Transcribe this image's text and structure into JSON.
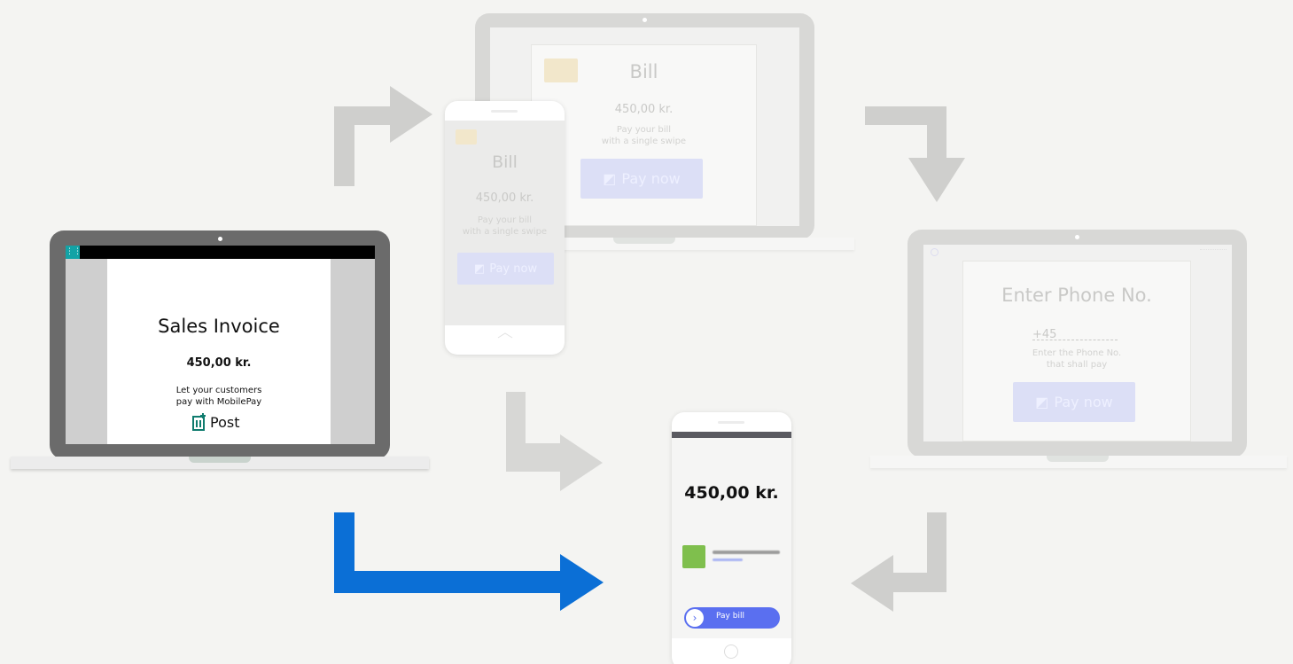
{
  "colors": {
    "background": "#f4f4f2",
    "arrow_gray": "#cfcfcd",
    "arrow_blue": "#0b6fd6",
    "accent_teal": "#13a3a6",
    "mobilepay_blue": "#5a6ff0"
  },
  "main_laptop": {
    "waffle_icon": "waffle-icon",
    "title": "Sales Invoice",
    "amount": "450,00 kr.",
    "desc_line1": "Let your customers",
    "desc_line2": "pay with MobilePay",
    "logo_text": "Post"
  },
  "laptop_bill": {
    "title": "Bill",
    "amount": "450,00 kr.",
    "desc_line1": "Pay your bill",
    "desc_line2": "with a single swipe",
    "button": "Pay now"
  },
  "phone_bill": {
    "title": "Bill",
    "amount": "450,00 kr.",
    "desc_line1": "Pay your bill",
    "desc_line2": "with a single swipe",
    "button": "Pay now"
  },
  "laptop_phone": {
    "title": "Enter Phone No.",
    "prefix": "+45",
    "desc_line1": "Enter the Phone No.",
    "desc_line2": "that shall pay",
    "button": "Pay now"
  },
  "phone_mobilepay": {
    "amount": "450,00 kr.",
    "slider_label": "Pay bill"
  }
}
